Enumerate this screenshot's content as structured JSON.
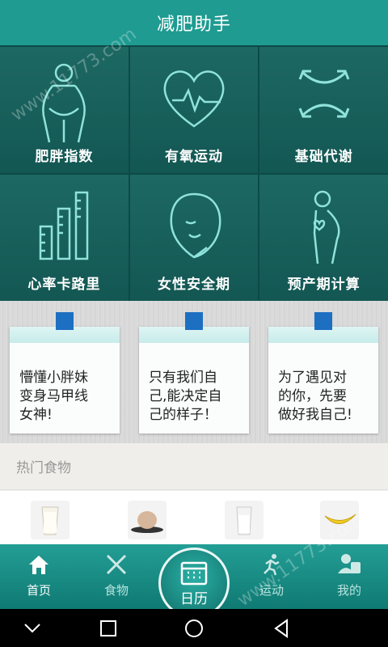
{
  "header": {
    "title": "减肥助手"
  },
  "tiles": [
    {
      "label": "肥胖指数",
      "icon": "body-fat-icon"
    },
    {
      "label": "有氧运动",
      "icon": "heart-pulse-icon"
    },
    {
      "label": "基础代谢",
      "icon": "metabolism-arrows-icon"
    },
    {
      "label": "心率卡路里",
      "icon": "bar-chart-ruler-icon"
    },
    {
      "label": "女性安全期",
      "icon": "woman-face-icon"
    },
    {
      "label": "预产期计算",
      "icon": "pregnant-woman-icon"
    }
  ],
  "notes": [
    {
      "lines": [
        "懵懂小胖妹",
        "变身马甲线",
        "女神!"
      ]
    },
    {
      "lines": [
        "只有我们自",
        "己,能决定自",
        "己的样子！"
      ]
    },
    {
      "lines": [
        "为了遇见对",
        "的你，先要",
        "做好我自己!"
      ]
    }
  ],
  "hot_foods": {
    "title": "热门食物",
    "items": [
      "milk-glass",
      "egg-plate",
      "milk-glass-2",
      "banana"
    ]
  },
  "bottom_nav": {
    "items": [
      {
        "label": "首页",
        "icon": "home-icon",
        "active": true
      },
      {
        "label": "食物",
        "icon": "knife-fork-icon",
        "active": false
      },
      {
        "label": "日历",
        "icon": "calendar-icon",
        "active": false
      },
      {
        "label": "运动",
        "icon": "running-icon",
        "active": false
      },
      {
        "label": "我的",
        "icon": "user-group-icon",
        "active": false
      }
    ]
  },
  "watermark": "www.11773.com",
  "colors": {
    "primary": "#1f9b91",
    "tile_bg": "#135753",
    "accent_blue": "#1d6fc2"
  }
}
